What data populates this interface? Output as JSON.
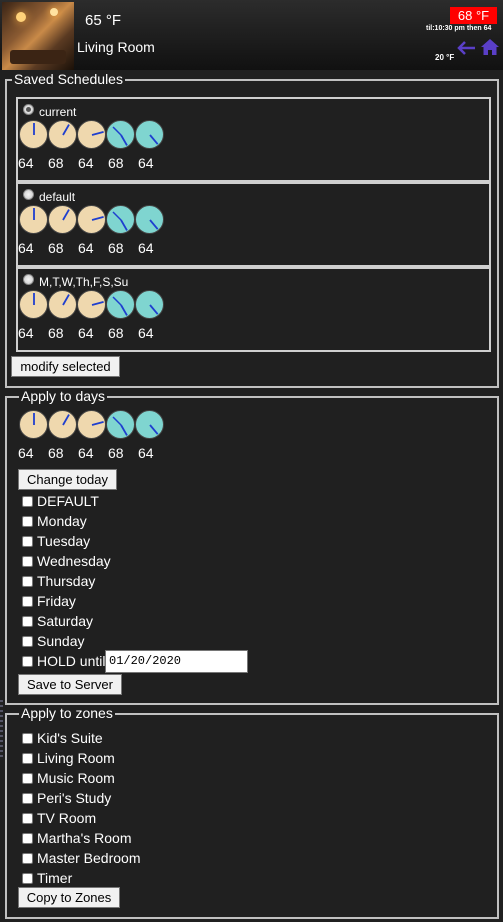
{
  "header": {
    "current_temp": "65 °F",
    "room_name": "Living Room",
    "setpoint": "68 °F",
    "until_text": "til:10:30 pm then 64",
    "outside_temp": "20 °F",
    "setpoint_color": "#ff0000",
    "icons": {
      "back": "back-arrow-icon",
      "home": "home-icon"
    }
  },
  "saved_schedules": {
    "legend": "Saved Schedules",
    "items": [
      {
        "name": "current",
        "selected": true,
        "temps": [
          "64",
          "68",
          "64",
          "68",
          "64"
        ]
      },
      {
        "name": "default",
        "selected": false,
        "temps": [
          "64",
          "68",
          "64",
          "68",
          "64"
        ]
      },
      {
        "name": "M,T,W,Th,F,S,Su",
        "selected": false,
        "temps": [
          "64",
          "68",
          "64",
          "68",
          "64"
        ]
      }
    ],
    "modify_button": "modify selected"
  },
  "apply_days": {
    "legend": "Apply to days",
    "temps": [
      "64",
      "68",
      "64",
      "68",
      "64"
    ],
    "change_button": "Change today",
    "days": [
      "DEFAULT",
      "Monday",
      "Tuesday",
      "Wednesday",
      "Thursday",
      "Friday",
      "Saturday",
      "Sunday"
    ],
    "hold_label": "HOLD until",
    "hold_date": "01/20/2020",
    "save_button": "Save to Server"
  },
  "apply_zones": {
    "legend": "Apply to zones",
    "zones": [
      "Kid's Suite",
      "Living Room",
      "Music Room",
      "Peri's Study",
      "TV Room",
      "Martha's Room",
      "Master Bedroom",
      "Timer"
    ],
    "copy_button": "Copy to Zones"
  },
  "colors": {
    "warm": "#efd8ae",
    "cool": "#7fd5d0",
    "hand": "#1f3fcf",
    "background": "#202020"
  }
}
